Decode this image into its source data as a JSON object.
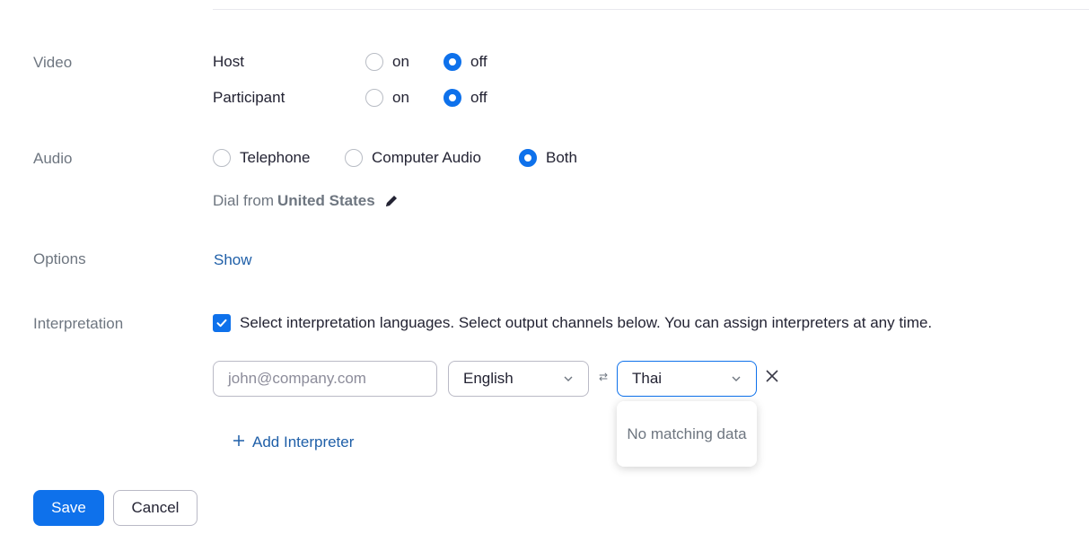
{
  "video": {
    "label": "Video",
    "host": {
      "label": "Host",
      "on": "on",
      "off": "off",
      "selected": "off"
    },
    "participant": {
      "label": "Participant",
      "on": "on",
      "off": "off",
      "selected": "off"
    }
  },
  "audio": {
    "label": "Audio",
    "options": [
      "Telephone",
      "Computer Audio",
      "Both"
    ],
    "selected": "Both",
    "dial_prefix": "Dial from",
    "dial_country": "United States"
  },
  "options": {
    "label": "Options",
    "show_link": "Show"
  },
  "interpretation": {
    "label": "Interpretation",
    "checkbox_text": "Select interpretation languages. Select output channels below. You can assign interpreters at any time.",
    "checked": true,
    "email_placeholder": "john@company.com",
    "source_language": "English",
    "target_language": "Thai",
    "dropdown_message": "No matching data",
    "swap_symbol": "⇄",
    "add_label": "Add Interpreter"
  },
  "actions": {
    "save": "Save",
    "cancel": "Cancel"
  },
  "colors": {
    "accent": "#0e71eb",
    "link": "#1f5fa8",
    "muted": "#6e7680"
  }
}
